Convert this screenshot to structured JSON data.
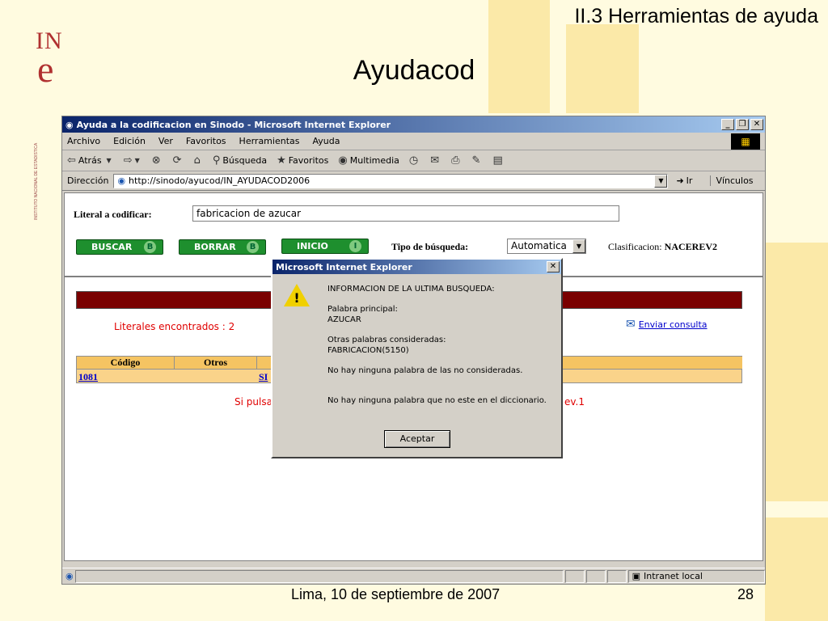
{
  "slide": {
    "section": "II.3 Herramientas de ayuda",
    "title": "Ayudacod",
    "logo_in": "IN",
    "logo_e": "e",
    "logo_tagline": "INSTITUTO NACIONAL DE ESTADISTICA",
    "footer_date": "Lima, 10 de septiembre de 2007",
    "page_number": "28",
    "accent_color": "#fbe9a8"
  },
  "browser": {
    "title": "Ayuda a la codificacion en Sinodo - Microsoft Internet Explorer",
    "menu": [
      "Archivo",
      "Edición",
      "Ver",
      "Favoritos",
      "Herramientas",
      "Ayuda"
    ],
    "toolbar": {
      "back": "Atrás",
      "search": "Búsqueda",
      "favorites": "Favoritos",
      "multimedia": "Multimedia"
    },
    "address_label": "Dirección",
    "address_value": "http://sinodo/ayucod/IN_AYUDACOD2006",
    "go_label": "Ir",
    "links_label": "Vínculos",
    "status_zone": "Intranet local"
  },
  "form": {
    "literal_label": "Literal a codificar:",
    "literal_value": "fabricacion de azucar",
    "buttons": {
      "buscar": "BUSCAR",
      "buscar_key": "B",
      "borrar": "BORRAR",
      "borrar_key": "B",
      "inicio": "INICIO",
      "inicio_key": "I"
    },
    "search_type_label": "Tipo de búsqueda:",
    "search_type_value": "Automatica",
    "classification_label": "Clasificacion:",
    "classification_value": "NACEREV2"
  },
  "results": {
    "found_text": "Literales encontrados : 2",
    "send_link": "Enviar consulta",
    "columns": [
      "Código",
      "Otros"
    ],
    "row": {
      "codigo": "1081",
      "otros": "SI"
    },
    "note_left": "Si pulsa",
    "note_right": "ev.1"
  },
  "dialog": {
    "title": "Microsoft Internet Explorer",
    "heading": "INFORMACION DE LA ULTIMA BUSQUEDA:",
    "main_word_label": "Palabra principal:",
    "main_word": "AZUCAR",
    "other_words_label": "Otras palabras consideradas:",
    "other_words": "FABRICACION(5150)",
    "no_unconsidered": "No hay ninguna palabra de las no consideradas.",
    "no_dictionary": "No hay ninguna palabra que no este en el diccionario.",
    "ok_label": "Aceptar"
  }
}
